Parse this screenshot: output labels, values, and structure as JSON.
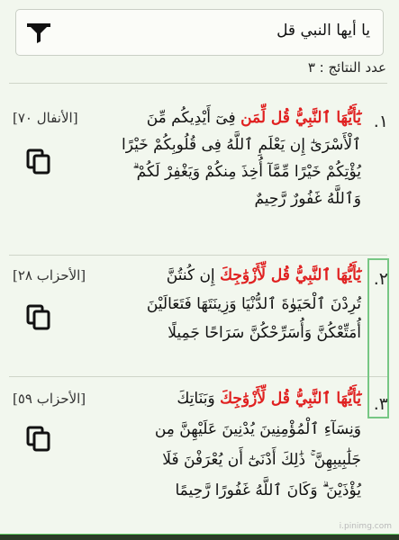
{
  "search": {
    "query": "يا أيها النبي قل"
  },
  "results_count": "عدد النتائج : ٣",
  "results": [
    {
      "number": "١.",
      "reference": "[الأنفال ٧٠]",
      "highlight": "يَٰٓأَيُّهَا ٱلنَّبِيُّ قُل لِّمَن",
      "line1_rest": "فِىٓ أَيْدِيكُم مِّنَ",
      "lines": [
        "ٱلْأَسْرَىٰٓ إِن يَعْلَمِ ٱللَّهُ فِى قُلُوبِكُمْ خَيْرًا",
        "يُؤْتِكُمْ خَيْرًا مِّمَّآ أُخِذَ مِنكُمْ وَيَغْفِرْ لَكُمْ ۗ",
        "وَٱللَّهُ غَفُورٌ رَّحِيمٌ"
      ]
    },
    {
      "number": "٢.",
      "reference": "[الأحزاب ٢٨]",
      "highlight": "يَٰٓأَيُّهَا ٱلنَّبِيُّ قُل لِّأَزْوَٰجِكَ",
      "line1_rest": "إِن كُنتُنَّ",
      "lines": [
        "تُرِدْنَ ٱلْحَيَوٰةَ ٱلدُّنْيَا وَزِينَتَهَا فَتَعَالَيْنَ",
        "أُمَتِّعْكُنَّ وَأُسَرِّحْكُنَّ سَرَاحًا جَمِيلًا"
      ]
    },
    {
      "number": "٣.",
      "reference": "[الأحزاب ٥٩]",
      "highlight": "يَٰٓأَيُّهَا ٱلنَّبِيُّ قُل لِّأَزْوَٰجِكَ",
      "line1_rest": "وَبَنَاتِكَ",
      "lines": [
        "وَنِسَآءِ ٱلْمُؤْمِنِينَ يُدْنِينَ عَلَيْهِنَّ مِن",
        "جَلَٰبِيبِهِنَّ ۚ ذَٰلِكَ أَدْنَىٰٓ أَن يُعْرَفْنَ فَلَا",
        "يُؤْذَيْنَ ۗ وَكَانَ ٱللَّهُ غَفُورًا رَّحِيمًا"
      ]
    }
  ],
  "watermark": "i.pinimg.com",
  "colors": {
    "background": "#f2f7ee",
    "highlight": "#e02020",
    "selection_border": "#77c784",
    "accent_bar": "#64d164"
  },
  "icons": {
    "filter": "filter-funnel-icon",
    "copy": "copy-icon"
  }
}
